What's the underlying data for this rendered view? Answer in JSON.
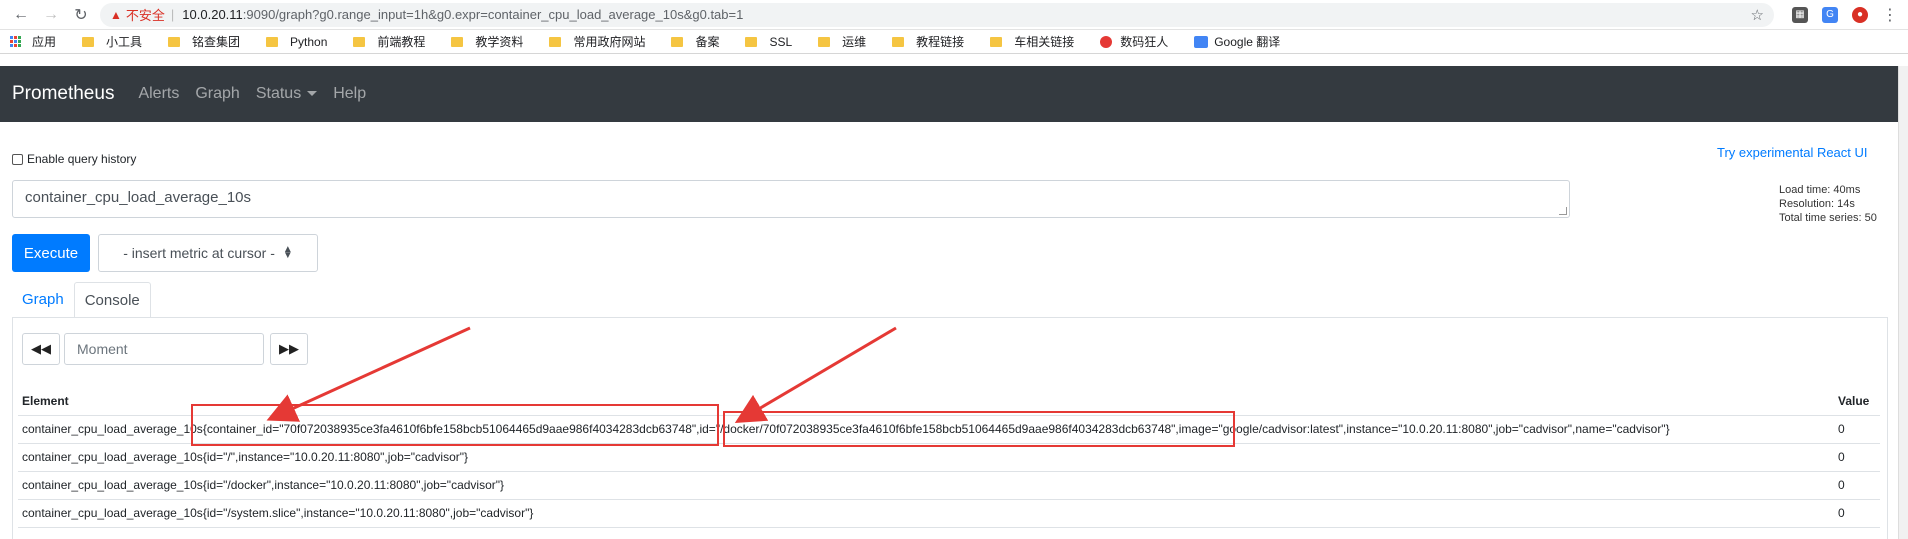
{
  "browser": {
    "insecure_label": "不安全",
    "url_host": "10.0.20.11",
    "url_rest": ":9090/graph?g0.range_input=1h&g0.expr=container_cpu_load_average_10s&g0.tab=1",
    "bookmarks": [
      {
        "label": "应用",
        "kind": "apps"
      },
      {
        "label": "小工具",
        "kind": "folder"
      },
      {
        "label": "铭查集团",
        "kind": "folder"
      },
      {
        "label": "Python",
        "kind": "folder"
      },
      {
        "label": "前端教程",
        "kind": "folder"
      },
      {
        "label": "教学资料",
        "kind": "folder"
      },
      {
        "label": "常用政府网站",
        "kind": "folder"
      },
      {
        "label": "备案",
        "kind": "folder"
      },
      {
        "label": "SSL",
        "kind": "folder"
      },
      {
        "label": "运维",
        "kind": "folder"
      },
      {
        "label": "教程链接",
        "kind": "folder"
      },
      {
        "label": "车相关链接",
        "kind": "folder"
      },
      {
        "label": "数码狂人",
        "kind": "red"
      },
      {
        "label": "Google 翻译",
        "kind": "translate"
      }
    ]
  },
  "navbar": {
    "brand": "Prometheus",
    "links": [
      "Alerts",
      "Graph",
      "Status",
      "Help"
    ]
  },
  "main": {
    "history_label": "Enable query history",
    "react_link": "Try experimental React UI",
    "query": "container_cpu_load_average_10s",
    "stats": {
      "load_time": "Load time: 40ms",
      "resolution": "Resolution: 14s",
      "total_series": "Total time series: 50"
    },
    "execute_label": "Execute",
    "metric_select": "- insert metric at cursor -",
    "tabs": [
      "Graph",
      "Console"
    ],
    "moment_placeholder": "Moment",
    "table": {
      "headers": [
        "Element",
        "Value"
      ],
      "rows": [
        {
          "prefix": "container_cpu_load_average_10s",
          "labels": "{container_id=\"70f072038935ce3fa4610f6bfe158bcb51064465d9aae986f4034283dcb63748\",id=\"/docker/70f072038935ce3fa4610f6bfe158bcb51064465d9aae986f4034283dcb63748\",image=\"google/cadvisor:latest\",instance=\"10.0.20.11:8080\",job=\"cadvisor\",name=\"cadvisor\"}",
          "value": "0"
        },
        {
          "prefix": "container_cpu_load_average_10s",
          "labels": "{id=\"/\",instance=\"10.0.20.11:8080\",job=\"cadvisor\"}",
          "value": "0"
        },
        {
          "prefix": "container_cpu_load_average_10s",
          "labels": "{id=\"/docker\",instance=\"10.0.20.11:8080\",job=\"cadvisor\"}",
          "value": "0"
        },
        {
          "prefix": "container_cpu_load_average_10s",
          "labels": "{id=\"/system.slice\",instance=\"10.0.20.11:8080\",job=\"cadvisor\"}",
          "value": "0"
        }
      ]
    }
  },
  "annotation_color": "#e53935"
}
